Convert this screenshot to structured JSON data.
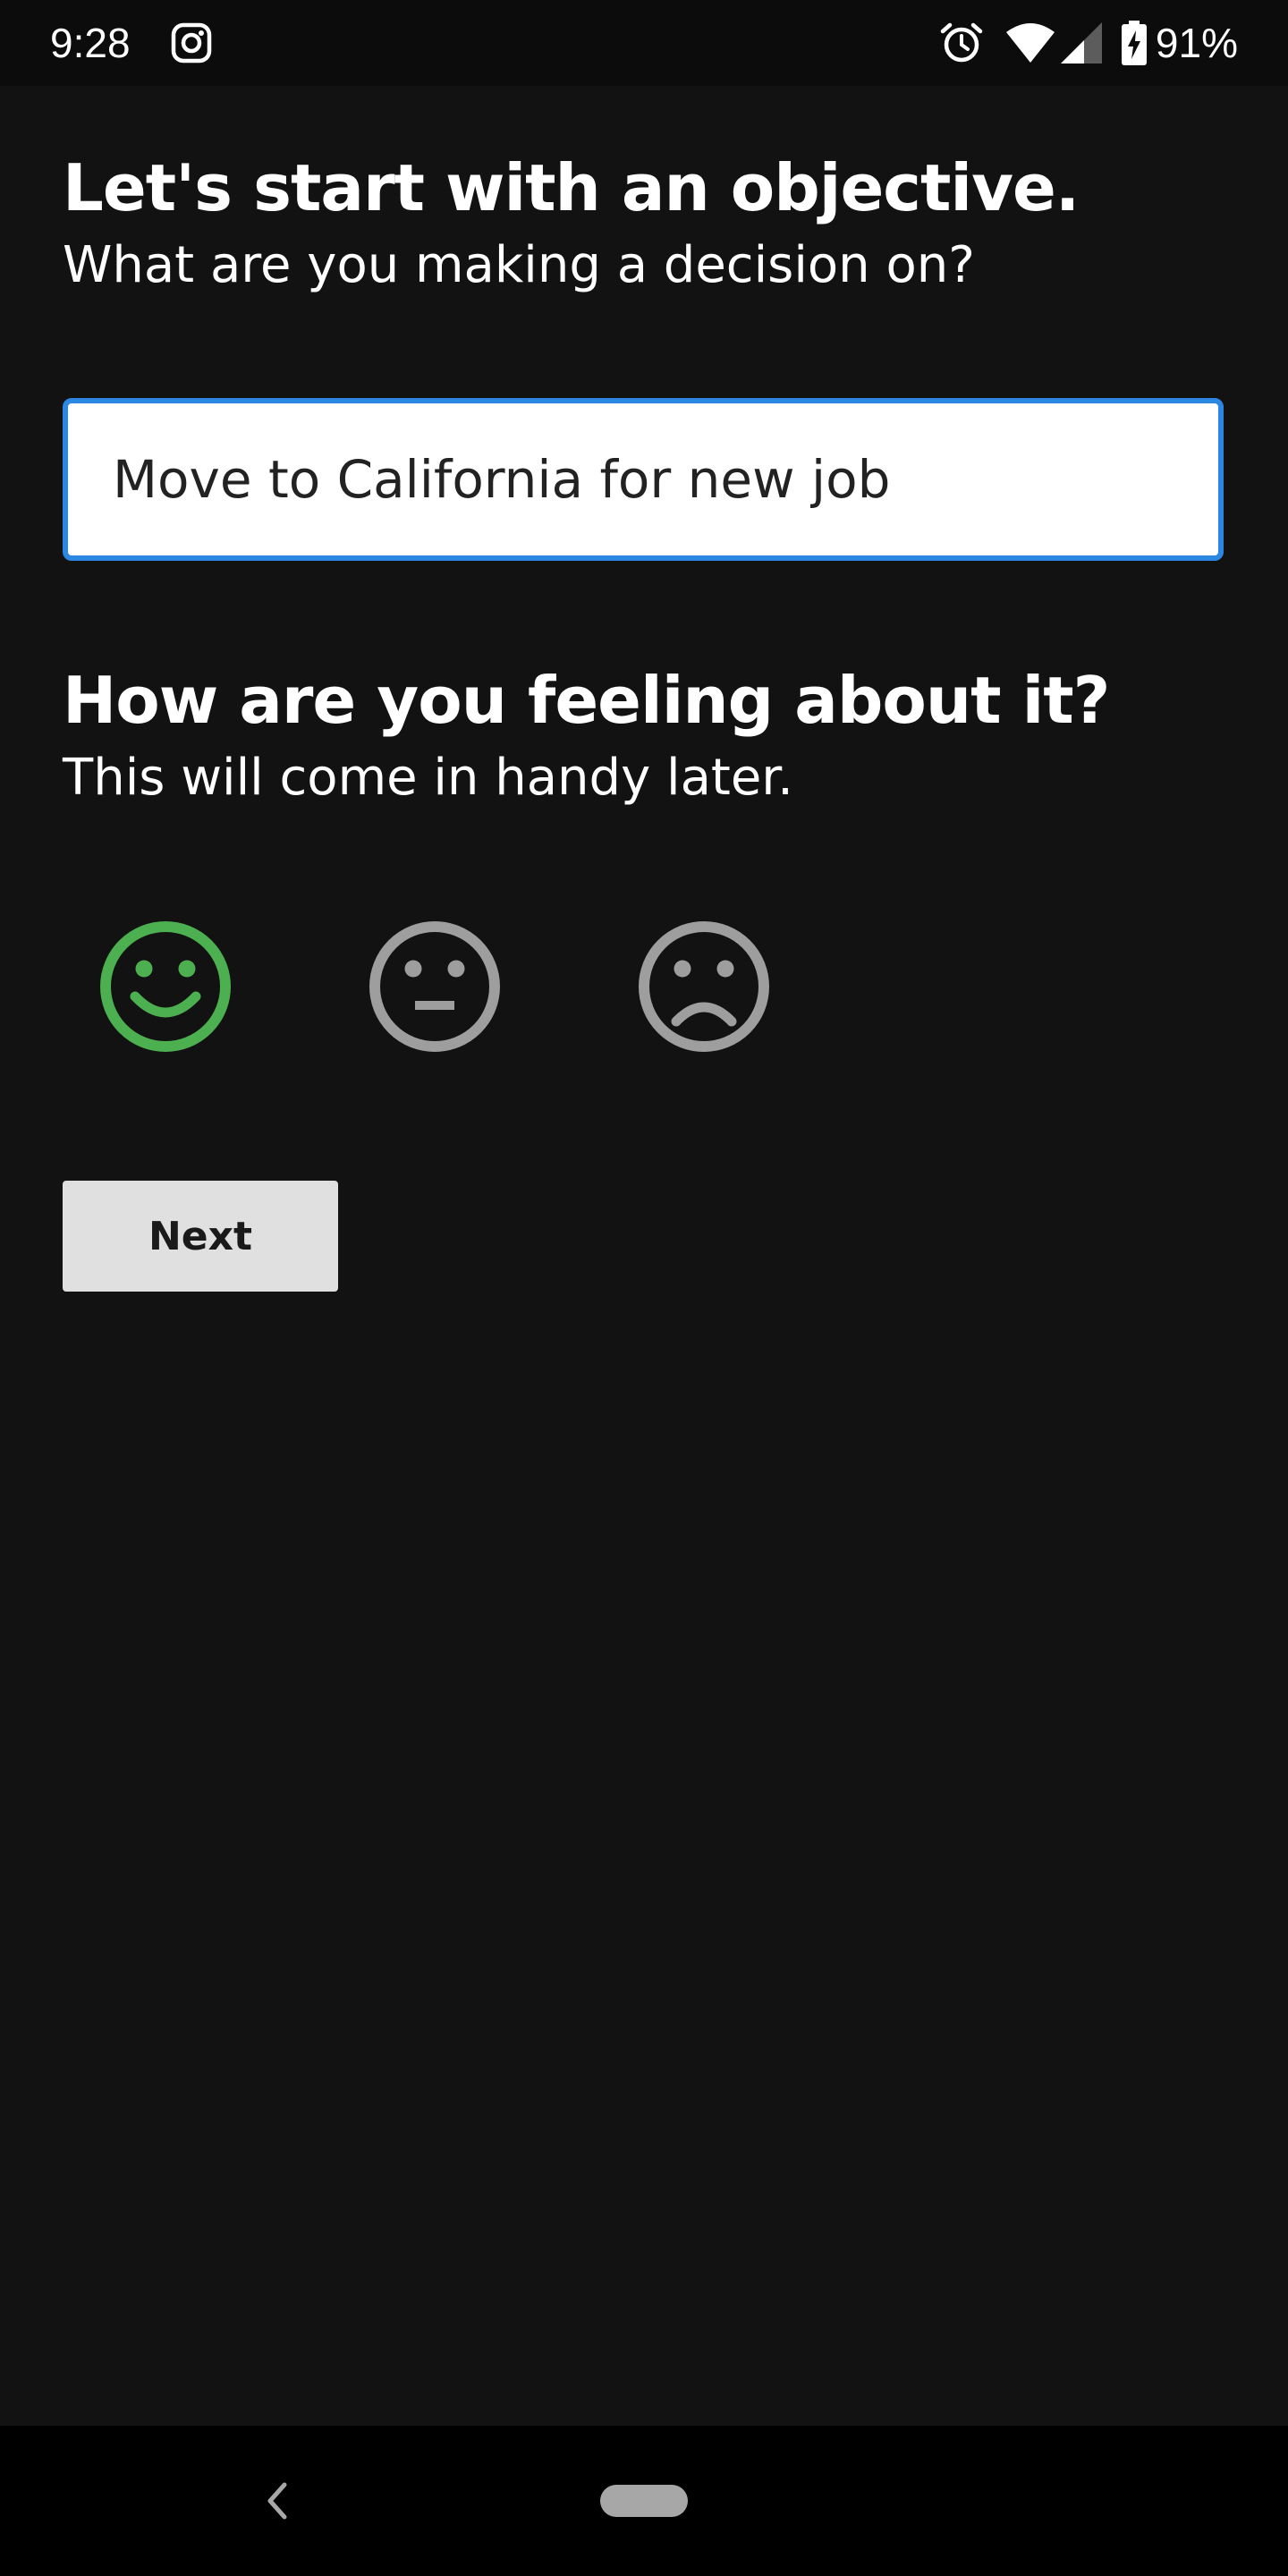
{
  "status_bar": {
    "time": "9:28",
    "battery_percent": "91%",
    "icons": [
      "instagram-icon",
      "alarm-icon",
      "wifi-icon",
      "cellular-signal-icon",
      "battery-charging-icon"
    ]
  },
  "objective_section": {
    "title": "Let's start with an objective.",
    "subtitle": "What are you making a decision on?",
    "input_value": "Move to California for new job"
  },
  "feeling_section": {
    "title": "How are you feeling about it?",
    "subtitle": "This will come in handy later.",
    "options": [
      {
        "name": "happy",
        "icon": "smiley-happy-icon",
        "selected": true
      },
      {
        "name": "neutral",
        "icon": "smiley-neutral-icon",
        "selected": false
      },
      {
        "name": "sad",
        "icon": "smiley-sad-icon",
        "selected": false
      }
    ],
    "colors": {
      "selected": "#4caf50",
      "unselected": "#9e9e9e"
    }
  },
  "next_button": {
    "label": "Next"
  },
  "navigation_bar": {
    "icons": [
      "back-icon",
      "home-pill-icon"
    ]
  },
  "colors": {
    "background": "#121212",
    "status_bar": "#0c0c0c",
    "input_border": "#2b87e2",
    "button_background": "#e0e0e0"
  }
}
